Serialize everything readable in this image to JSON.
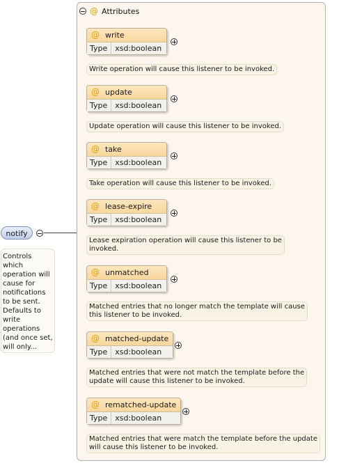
{
  "attributes": {
    "title": "Attributes",
    "at_symbol": "@",
    "items": [
      {
        "name": "write",
        "type_label": "Type",
        "type_value": "xsd:boolean",
        "doc": "Write operation will cause this listener to be invoked."
      },
      {
        "name": "update",
        "type_label": "Type",
        "type_value": "xsd:boolean",
        "doc": "Update operation will cause this listener to be invoked."
      },
      {
        "name": "take",
        "type_label": "Type",
        "type_value": "xsd:boolean",
        "doc": "Take operation will cause this listener to be invoked."
      },
      {
        "name": "lease-expire",
        "type_label": "Type",
        "type_value": "xsd:boolean",
        "doc": "Lease expiration operation will cause this listener to be\ninvoked."
      },
      {
        "name": "unmatched",
        "type_label": "Type",
        "type_value": "xsd:boolean",
        "doc": "Matched entries that no longer match the template will cause\nthis listener to be invoked."
      },
      {
        "name": "matched-update",
        "type_label": "Type",
        "type_value": "xsd:boolean",
        "doc": "Matched entries that were not match the template before the\nupdate will cause this listener to be invoked."
      },
      {
        "name": "rematched-update",
        "type_label": "Type",
        "type_value": "xsd:boolean",
        "doc": "Matched entries that were match the template before the update\nwill cause this listener to be invoked."
      }
    ]
  },
  "element": {
    "name": "notify",
    "doc": "Controls\nwhich\noperation will\ncause for\nnotifications\nto be sent.\nDefaults to\nwrite\noperations\n(and once set,\nwill only..."
  },
  "colors": {
    "attribute_header": "#f8d79c",
    "element_fill": "#c3cfea",
    "group_background": "#fcf6ee"
  },
  "icons": {
    "collapse": "minus-circle-icon",
    "expand": "plus-circle-icon",
    "attribute": "at-icon"
  }
}
